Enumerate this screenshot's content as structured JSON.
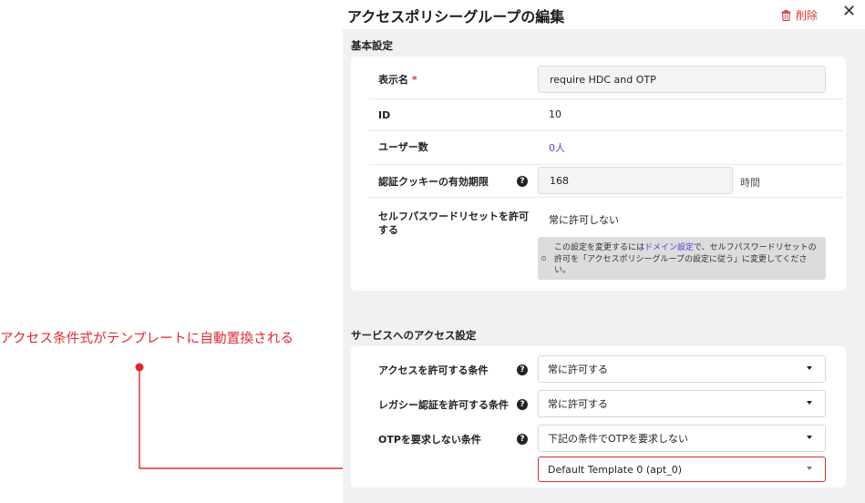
{
  "annotation": {
    "text": "アクセス条件式がテンプレートに自動置換される"
  },
  "header": {
    "title": "アクセスポリシーグループの編集",
    "delete_label": "削除",
    "close_label": "✕"
  },
  "basic": {
    "section_title": "基本設定",
    "display_name": {
      "label": "表示名",
      "required_mark": "*",
      "value": "require HDC and OTP"
    },
    "id": {
      "label": "ID",
      "value": "10"
    },
    "users": {
      "label": "ユーザー数",
      "value": "0人"
    },
    "cookie": {
      "label": "認証クッキーの有効期限",
      "value": "168",
      "unit": "時間"
    },
    "self_reset": {
      "label": "セルフパスワードリセットを許可する",
      "value": "常に許可しない",
      "note_pre": "この設定を変更するには",
      "note_link": "ドメイン設定",
      "note_post": "で、セルフパスワードリセットの許可を「アクセスポリシーグループの設定に従う」に変更してください。"
    }
  },
  "access": {
    "section_title": "サービスへのアクセス設定",
    "allow": {
      "label": "アクセスを許可する条件",
      "value": "常に許可する"
    },
    "legacy": {
      "label": "レガシー認証を許可する条件",
      "value": "常に許可する"
    },
    "otp": {
      "label": "OTPを要求しない条件",
      "value": "下記の条件でOTPを要求しない"
    },
    "template": {
      "value": "Default Template 0 (apt_0)"
    }
  },
  "icons": {
    "help": "?",
    "info": "⊙"
  },
  "colors": {
    "accent_red": "#e0282e",
    "link_purple": "#5b3fc4",
    "delete_red": "#d63b3b"
  }
}
